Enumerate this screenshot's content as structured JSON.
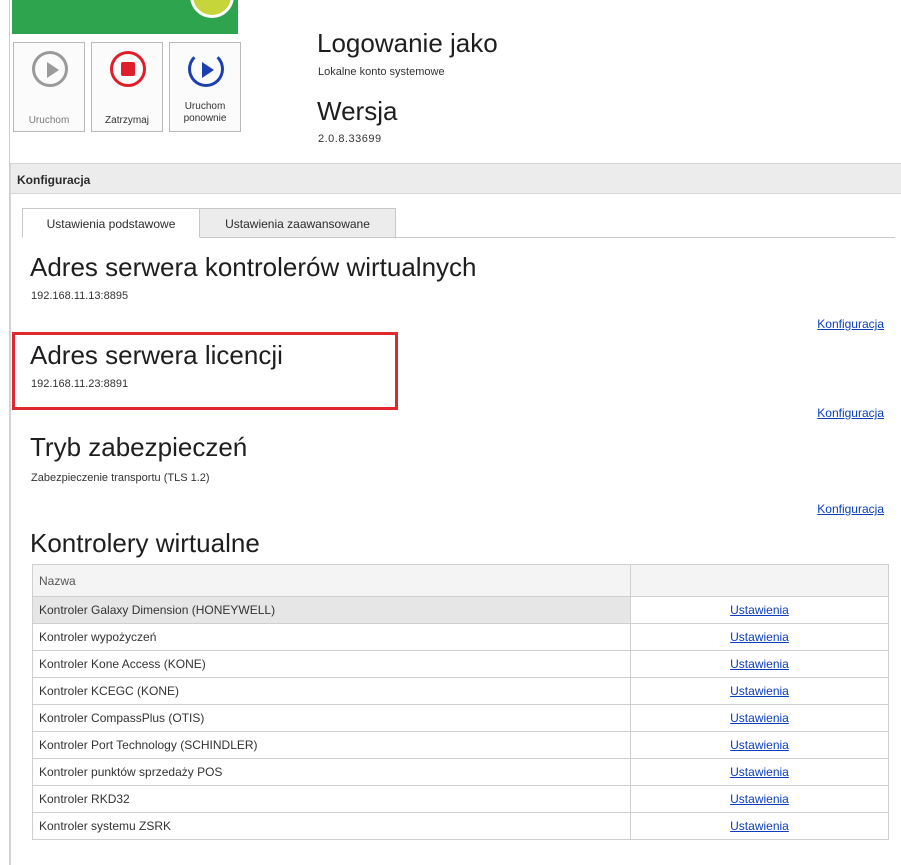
{
  "controls": {
    "start_label": "Uruchom",
    "stop_label": "Zatrzymaj",
    "restart_label_line1": "Uruchom",
    "restart_label_line2": "ponownie"
  },
  "service": {
    "login_title": "Logowanie jako",
    "login_value": "Lokalne konto systemowe",
    "version_title": "Wersja",
    "version_value": "2.0.8.33699"
  },
  "config": {
    "header": "Konfiguracja",
    "tabs": [
      {
        "label": "Ustawienia podstawowe",
        "active": true
      },
      {
        "label": "Ustawienia zaawansowane",
        "active": false
      }
    ],
    "sections": [
      {
        "title": "Adres serwera kontrolerów wirtualnych",
        "value": "192.168.11.13:8895",
        "link": "Konfiguracja"
      },
      {
        "title": "Adres serwera licencji",
        "value": "192.168.11.23:8891",
        "link": "Konfiguracja"
      },
      {
        "title": "Tryb zabezpieczeń",
        "value": "Zabezpieczenie transportu (TLS 1.2)",
        "link": "Konfiguracja"
      }
    ],
    "controllers_title": "Kontrolery wirtualne"
  },
  "controllers_table": {
    "columns": [
      "Nazwa",
      ""
    ],
    "rows": [
      {
        "name": "Kontroler Galaxy Dimension (HONEYWELL)",
        "action": "Ustawienia"
      },
      {
        "name": "Kontroler wypożyczeń",
        "action": "Ustawienia"
      },
      {
        "name": "Kontroler Kone Access (KONE)",
        "action": "Ustawienia"
      },
      {
        "name": "Kontroler KCEGC (KONE)",
        "action": "Ustawienia"
      },
      {
        "name": "Kontroler CompassPlus (OTIS)",
        "action": "Ustawienia"
      },
      {
        "name": "Kontroler Port Technology (SCHINDLER)",
        "action": "Ustawienia"
      },
      {
        "name": "Kontroler punktów sprzedaży POS",
        "action": "Ustawienia"
      },
      {
        "name": "Kontroler RKD32",
        "action": "Ustawienia"
      },
      {
        "name": "Kontroler systemu ZSRK",
        "action": "Ustawienia"
      }
    ]
  },
  "colors": {
    "link": "#0b3dbf",
    "highlight": "#e0282f",
    "stop": "#e01d2a",
    "restart": "#1c3fb0"
  }
}
